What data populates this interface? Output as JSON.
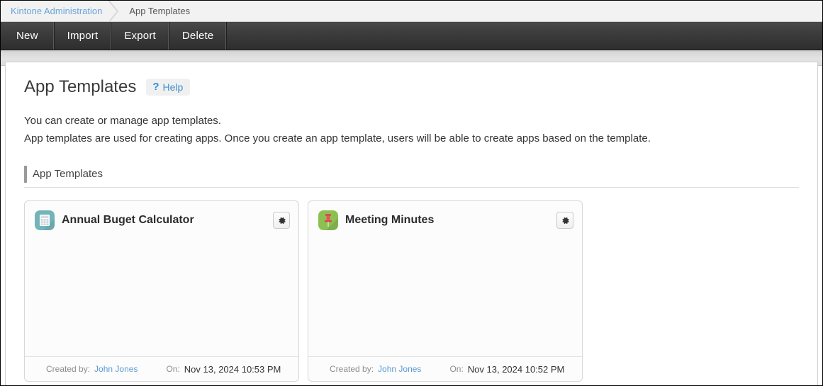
{
  "breadcrumb": {
    "root": "Kintone Administration",
    "separator_icon": "chevron-right-icon",
    "current": "App Templates"
  },
  "toolbar": {
    "buttons": [
      {
        "label": "New"
      },
      {
        "label": "Import"
      },
      {
        "label": "Export"
      },
      {
        "label": "Delete"
      }
    ]
  },
  "page": {
    "title": "App Templates",
    "help": {
      "icon": "question-mark-icon",
      "label": "Help"
    },
    "description_line1": "You can create or manage app templates.",
    "description_line2": "App templates are used for creating apps. Once you create an app template, users will be able to create apps based on the template.",
    "section_label": "App Templates"
  },
  "cards": [
    {
      "title": "Annual Buget Calculator",
      "icon": "calculator-app-icon",
      "icon_color": "#71b5bb",
      "settings_icon": "gear-icon",
      "created_by_label": "Created by:",
      "created_by": "John Jones",
      "on_label": "On:",
      "created_on": "Nov 13, 2024 10:53 PM"
    },
    {
      "title": "Meeting Minutes",
      "icon": "pushpin-app-icon",
      "icon_color": "#8cc152",
      "settings_icon": "gear-icon",
      "created_by_label": "Created by:",
      "created_by": "John Jones",
      "on_label": "On:",
      "created_on": "Nov 13, 2024 10:52 PM"
    }
  ],
  "colors": {
    "toolbar_bg": "#3b3b3b",
    "link": "#5b9bd5",
    "accent_bar": "#9a9a9a",
    "help_blue": "#3e8fd0"
  }
}
